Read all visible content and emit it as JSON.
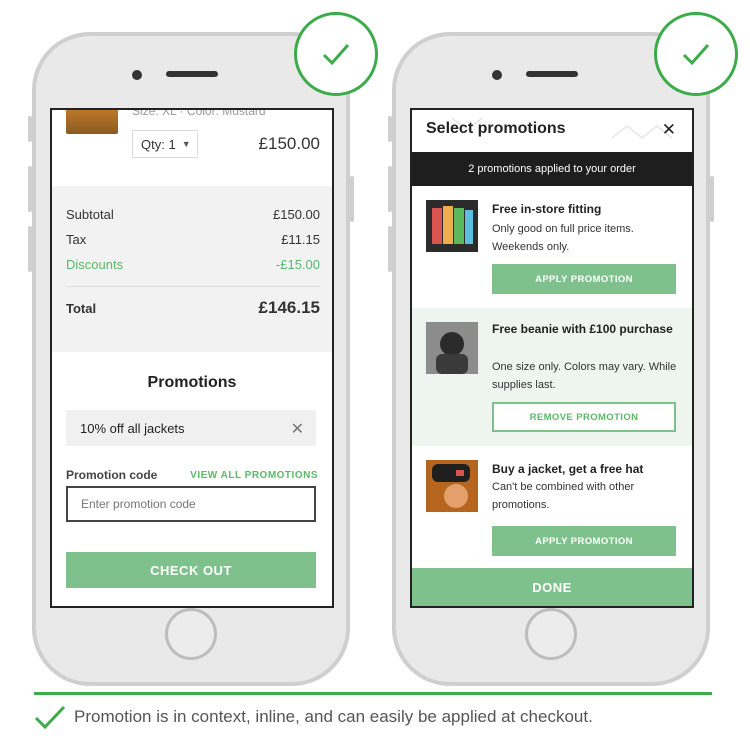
{
  "left_screen": {
    "product": {
      "meta": "Size: XL  ·  Color: Mustard",
      "qty_label": "Qty: 1",
      "price": "£150.00"
    },
    "summary": {
      "subtotal_label": "Subtotal",
      "subtotal_value": "£150.00",
      "tax_label": "Tax",
      "tax_value": "£11.15",
      "discounts_label": "Discounts",
      "discounts_value": "-£15.00",
      "total_label": "Total",
      "total_value": "£146.15"
    },
    "promotions": {
      "title": "Promotions",
      "applied_promo": "10% off all jackets",
      "code_label": "Promotion code",
      "view_all": "VIEW ALL PROMOTIONS",
      "input_placeholder": "Enter promotion code",
      "checkout_label": "CHECK OUT"
    }
  },
  "right_screen": {
    "title": "Select promotions",
    "banner": "2 promotions applied to your order",
    "promos": [
      {
        "title": "Free in-store fitting",
        "description": "Only good on full price items. Weekends only.",
        "button": "APPLY PROMOTION"
      },
      {
        "title": "Free beanie with £100 purchase",
        "description": "One size only. Colors may vary. While supplies last.",
        "button": "REMOVE PROMOTION"
      },
      {
        "title": "Buy a jacket, get a free hat",
        "description": "Can't be combined with other promotions.",
        "button": "APPLY PROMOTION"
      }
    ],
    "done_label": "DONE"
  },
  "caption": "Promotion is in context, inline, and can easily be applied at checkout.",
  "icons": [
    "check-icon",
    "close-icon",
    "chevron-down-icon"
  ],
  "colors": {
    "accent_green": "#7fc18d",
    "check_green": "#3cab4a",
    "banner_dark": "#1e1e1e"
  }
}
